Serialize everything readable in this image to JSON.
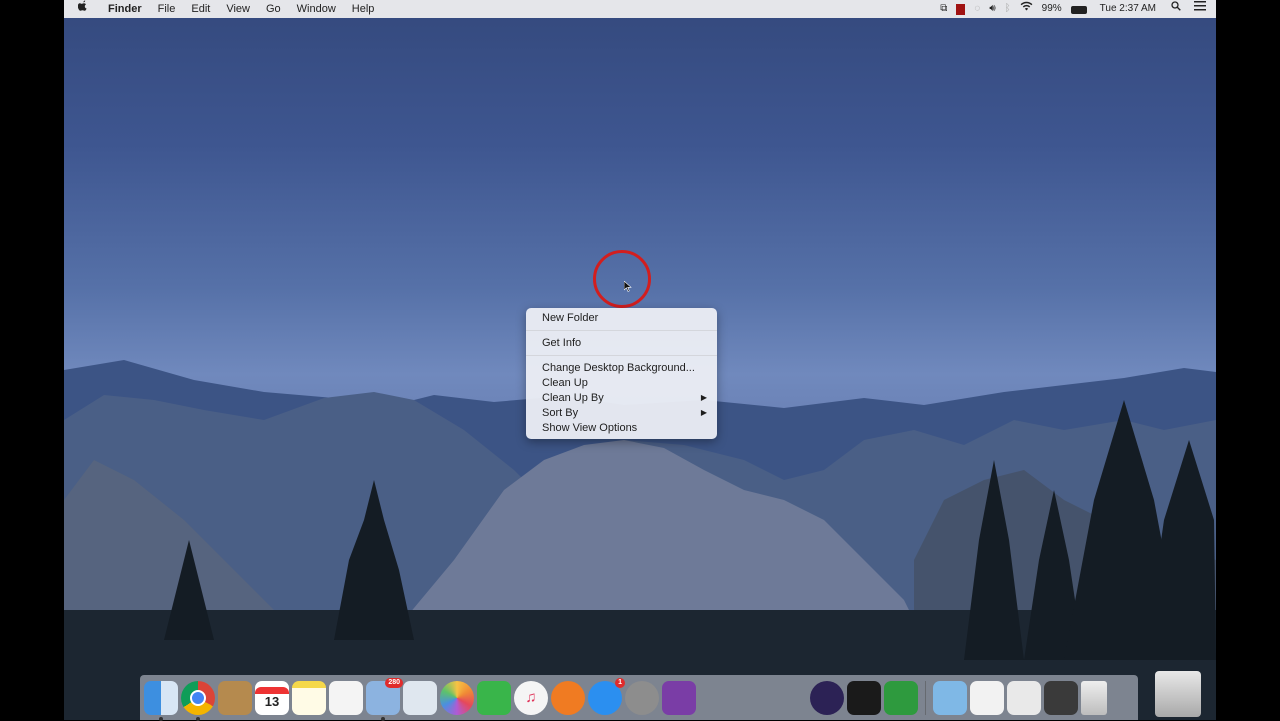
{
  "menubar": {
    "apple_icon": "apple-icon",
    "items": [
      "Finder",
      "File",
      "Edit",
      "View",
      "Go",
      "Window",
      "Help"
    ],
    "battery": "99%",
    "clock": "Tue 2:37 AM"
  },
  "context_menu": {
    "items": [
      {
        "label": "New Folder"
      },
      {
        "label": "Get Info"
      },
      {
        "label": "Change Desktop Background..."
      },
      {
        "label": "Clean Up"
      },
      {
        "label": "Clean Up By",
        "submenu": true
      },
      {
        "label": "Sort By",
        "submenu": true
      },
      {
        "label": "Show View Options"
      }
    ]
  },
  "dock": {
    "calendar_day": "13",
    "mail_badge": "280",
    "appstore_badge": "1"
  }
}
